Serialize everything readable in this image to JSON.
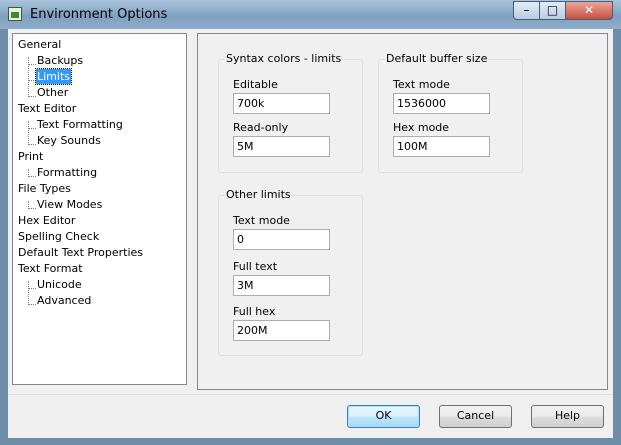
{
  "window": {
    "title": "Environment Options"
  },
  "titlebar_buttons": {
    "minimize": "–",
    "maximize": "□",
    "close": "✕"
  },
  "tree": {
    "items": [
      {
        "label": "General",
        "level": 0
      },
      {
        "label": "Backups",
        "level": 1
      },
      {
        "label": "Limits",
        "level": 1,
        "selected": true
      },
      {
        "label": "Other",
        "level": 1
      },
      {
        "label": "Text Editor",
        "level": 0
      },
      {
        "label": "Text Formatting",
        "level": 1
      },
      {
        "label": "Key Sounds",
        "level": 1
      },
      {
        "label": "Print",
        "level": 0
      },
      {
        "label": "Formatting",
        "level": 1
      },
      {
        "label": "File Types",
        "level": 0
      },
      {
        "label": "View Modes",
        "level": 1
      },
      {
        "label": "Hex Editor",
        "level": 0
      },
      {
        "label": "Spelling Check",
        "level": 0
      },
      {
        "label": "Default Text Properties",
        "level": 0
      },
      {
        "label": "Text Format",
        "level": 0
      },
      {
        "label": "Unicode",
        "level": 1
      },
      {
        "label": "Advanced",
        "level": 1
      }
    ]
  },
  "syntax_limits": {
    "title": "Syntax colors - limits",
    "editable": {
      "label": "Editable",
      "value": "700k"
    },
    "readonly": {
      "label": "Read-only",
      "value": "5M"
    }
  },
  "buffer_size": {
    "title": "Default buffer size",
    "text_mode": {
      "label": "Text mode",
      "value": "1536000"
    },
    "hex_mode": {
      "label": "Hex mode",
      "value": "100M"
    }
  },
  "other_limits": {
    "title": "Other limits",
    "text_mode": {
      "label": "Text mode",
      "value": "0"
    },
    "full_text": {
      "label": "Full text",
      "value": "3M"
    },
    "full_hex": {
      "label": "Full hex",
      "value": "200M"
    }
  },
  "buttons": {
    "ok": "OK",
    "cancel": "Cancel",
    "help": "Help"
  }
}
